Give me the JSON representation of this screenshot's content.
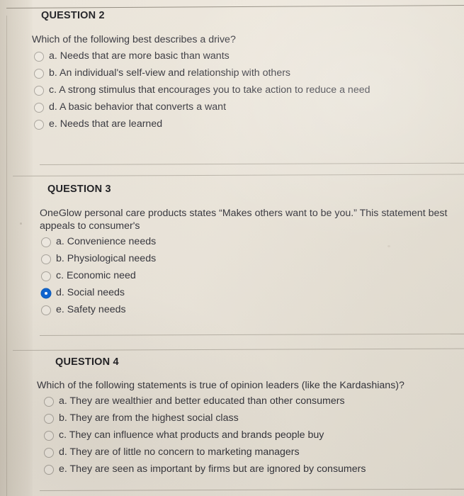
{
  "page": {
    "background_color": "#e9e3d8",
    "text_color": "#33333a",
    "selected_radio_color": "#0b63d2"
  },
  "questions": [
    {
      "title": "QUESTION 2",
      "text": "Which of the following best describes a drive?",
      "options": [
        {
          "label": "a. Needs that are more basic than wants",
          "selected": false
        },
        {
          "label": "b. An individual's self-view and relationship with others",
          "selected": false
        },
        {
          "label": "c. A strong stimulus that encourages you to take action to reduce a need",
          "selected": false
        },
        {
          "label": "d. A basic behavior that converts a want",
          "selected": false
        },
        {
          "label": "e. Needs that are learned",
          "selected": false
        }
      ]
    },
    {
      "title": "QUESTION 3",
      "text": "OneGlow personal care products states “Makes others want to be you.” This statement best appeals to consumer's",
      "options": [
        {
          "label": "a. Convenience needs",
          "selected": false
        },
        {
          "label": "b. Physiological needs",
          "selected": false
        },
        {
          "label": "c. Economic need",
          "selected": false
        },
        {
          "label": "d. Social needs",
          "selected": true
        },
        {
          "label": "e. Safety needs",
          "selected": false
        }
      ]
    },
    {
      "title": "QUESTION 4",
      "text": "Which of the following statements is true of opinion leaders (like the Kardashians)?",
      "options": [
        {
          "label": "a. They are wealthier and better educated than other consumers",
          "selected": false
        },
        {
          "label": "b. They are from the highest social class",
          "selected": false
        },
        {
          "label": "c. They can influence what products and brands people buy",
          "selected": false
        },
        {
          "label": "d. They are of little no concern to marketing managers",
          "selected": false
        },
        {
          "label": "e. They are seen as important by firms but are ignored by consumers",
          "selected": false
        }
      ]
    }
  ]
}
